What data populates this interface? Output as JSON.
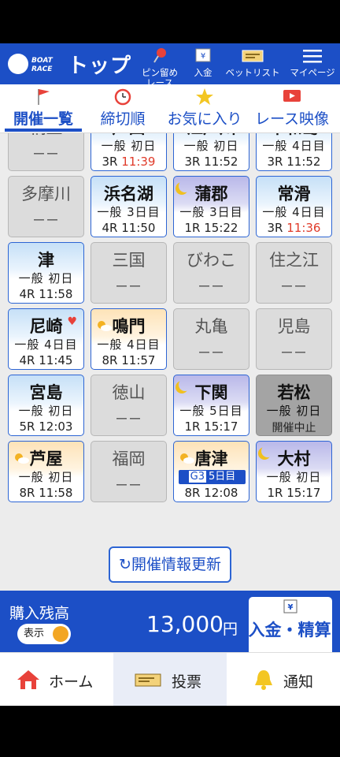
{
  "header": {
    "logo_line1": "BOAT",
    "logo_line2": "RACE",
    "title": "トップ",
    "buttons": [
      {
        "label": "ピン留め\nレース",
        "icon": "pin-icon"
      },
      {
        "label": "入金",
        "icon": "deposit-icon"
      },
      {
        "label": "ベットリスト",
        "icon": "betlist-icon"
      },
      {
        "label": "マイページ",
        "icon": "menu-icon"
      }
    ]
  },
  "tabs": [
    {
      "label": "開催一覧",
      "icon": "flag-icon",
      "active": true
    },
    {
      "label": "締切順",
      "icon": "alarm-clock-icon"
    },
    {
      "label": "お気に入り",
      "icon": "star-icon"
    },
    {
      "label": "レース映像",
      "icon": "video-icon"
    }
  ],
  "venues": [
    {
      "name": "桐生",
      "status": "inactive",
      "dash": "ーー"
    },
    {
      "name": "戸田",
      "status": "active",
      "theme": "day",
      "grade": "一般 初日",
      "race": "3R",
      "time": "11:39",
      "late": true
    },
    {
      "name": "江戸川",
      "status": "active",
      "theme": "day",
      "grade": "一般 初日",
      "race": "3R",
      "time": "11:52"
    },
    {
      "name": "平和島",
      "status": "active",
      "theme": "day",
      "grade": "一般 4日目",
      "race": "3R",
      "time": "11:52"
    },
    {
      "name": "多摩川",
      "status": "inactive",
      "dash": "ーー"
    },
    {
      "name": "浜名湖",
      "status": "active",
      "theme": "day",
      "grade": "一般 3日目",
      "race": "4R",
      "time": "11:50"
    },
    {
      "name": "蒲郡",
      "status": "active",
      "theme": "night",
      "grade": "一般 3日目",
      "race": "1R",
      "time": "15:22"
    },
    {
      "name": "常滑",
      "status": "active",
      "theme": "day",
      "grade": "一般 4日目",
      "race": "3R",
      "time": "11:36",
      "late": true
    },
    {
      "name": "津",
      "status": "active",
      "theme": "day",
      "grade": "一般 初日",
      "race": "4R",
      "time": "11:58"
    },
    {
      "name": "三国",
      "status": "inactive",
      "dash": "ーー"
    },
    {
      "name": "びわこ",
      "status": "inactive",
      "dash": "ーー"
    },
    {
      "name": "住之江",
      "status": "inactive",
      "dash": "ーー"
    },
    {
      "name": "尼崎",
      "status": "active",
      "theme": "day",
      "grade": "一般 4日目",
      "race": "4R",
      "time": "11:45",
      "favorite": true
    },
    {
      "name": "鳴門",
      "status": "active",
      "theme": "sun",
      "grade": "一般 4日目",
      "race": "8R",
      "time": "11:57"
    },
    {
      "name": "丸亀",
      "status": "inactive",
      "dash": "ーー"
    },
    {
      "name": "児島",
      "status": "inactive",
      "dash": "ーー"
    },
    {
      "name": "宮島",
      "status": "active",
      "theme": "day",
      "grade": "一般 初日",
      "race": "5R",
      "time": "12:03"
    },
    {
      "name": "徳山",
      "status": "inactive",
      "dash": "ーー"
    },
    {
      "name": "下関",
      "status": "active",
      "theme": "night",
      "grade": "一般 5日目",
      "race": "1R",
      "time": "15:17"
    },
    {
      "name": "若松",
      "status": "cancelled",
      "grade": "一般 初日",
      "note": "開催中止"
    },
    {
      "name": "芦屋",
      "status": "active",
      "theme": "sun",
      "grade": "一般 初日",
      "race": "8R",
      "time": "11:58"
    },
    {
      "name": "福岡",
      "status": "inactive",
      "dash": "ーー"
    },
    {
      "name": "唐津",
      "status": "active",
      "theme": "sun",
      "badge_grade": "G3",
      "badge_day": "5日目",
      "race": "8R",
      "time": "12:08"
    },
    {
      "name": "大村",
      "status": "active",
      "theme": "night",
      "grade": "一般 初日",
      "race": "1R",
      "time": "15:17"
    }
  ],
  "refresh_label": "開催情報更新",
  "balance": {
    "label": "購入残高",
    "toggle_label": "表示",
    "amount": "13,000",
    "unit": "円",
    "settle_label": "入金・精算"
  },
  "bottom_nav": [
    {
      "label": "ホーム",
      "icon": "home-icon"
    },
    {
      "label": "投票",
      "icon": "ticket-icon"
    },
    {
      "label": "通知",
      "icon": "bell-icon"
    }
  ],
  "colors": {
    "brand": "#1c4fc6",
    "late": "#e03b2a",
    "cancelled": "#a4a4a4"
  }
}
